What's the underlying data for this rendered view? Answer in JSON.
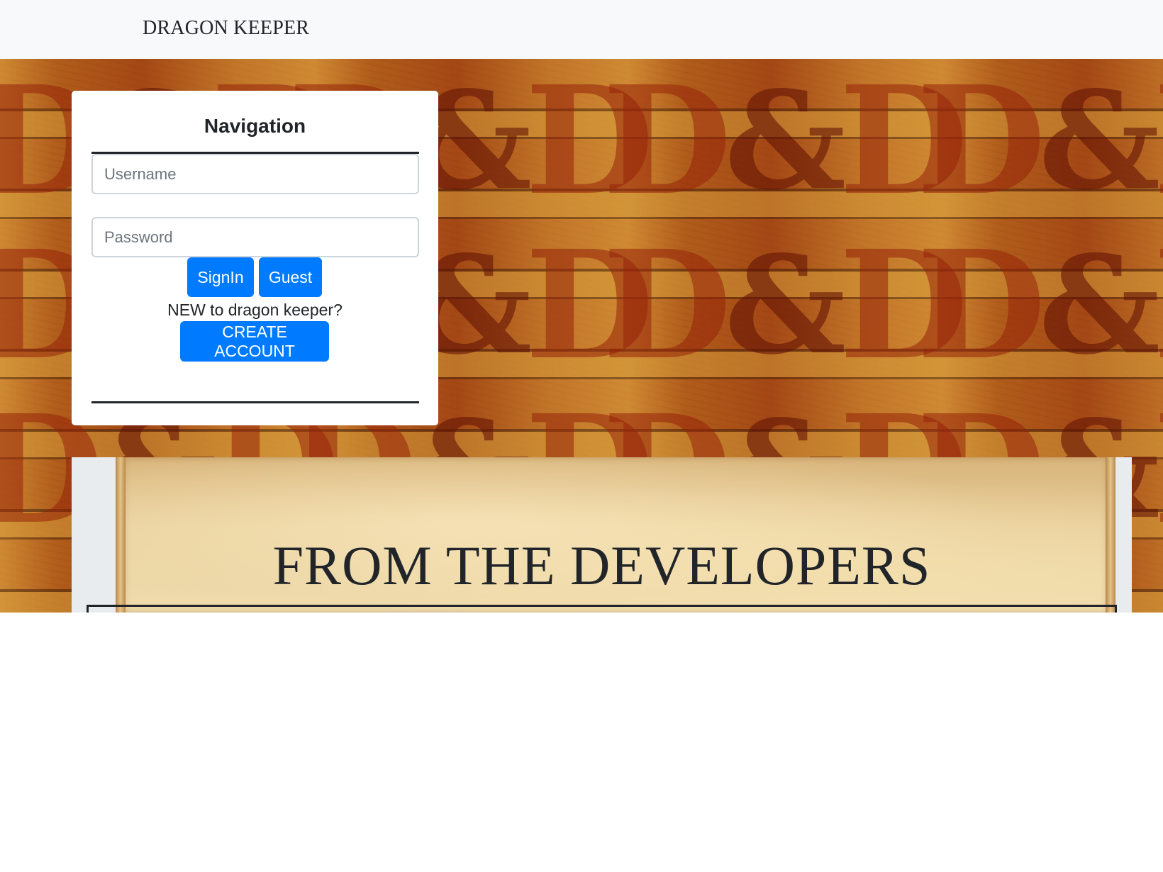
{
  "navbar": {
    "brand": "DRAGON KEEPER"
  },
  "login": {
    "title": "Navigation",
    "username_placeholder": "Username",
    "password_placeholder": "Password",
    "signin_label": "SignIn",
    "guest_label": "Guest",
    "new_prompt": "NEW to dragon keeper?",
    "create_account_label": "CREATE ACCOUNT"
  },
  "developers": {
    "title": "FROM THE DEVELOPERS"
  },
  "colors": {
    "primary_button": "#007bff",
    "navbar_bg": "#f8f9fa",
    "text": "#212529"
  }
}
